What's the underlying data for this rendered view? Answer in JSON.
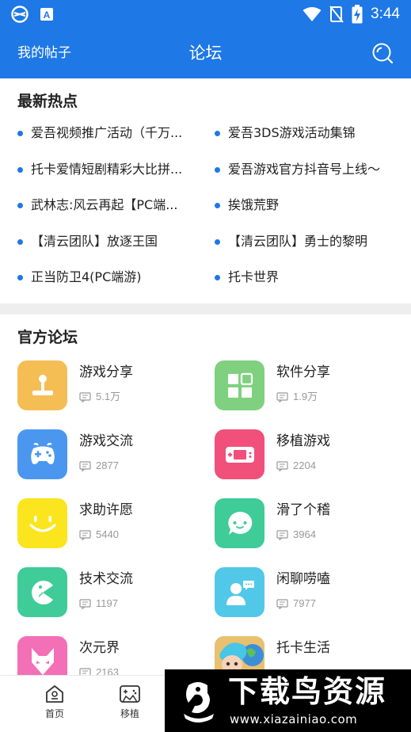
{
  "status_bar": {
    "time": "3:44"
  },
  "header": {
    "my_posts": "我的帖子",
    "title": "论坛"
  },
  "hot": {
    "title": "最新热点",
    "items": [
      {
        "label": "爱吾视频推广活动（千万..."
      },
      {
        "label": "爱吾3DS游戏活动集锦"
      },
      {
        "label": "托卡爱情短剧精彩大比拼..."
      },
      {
        "label": "爱吾游戏官方抖音号上线～"
      },
      {
        "label": "武林志:风云再起【PC端..."
      },
      {
        "label": "挨饿荒野"
      },
      {
        "label": "【清云团队】放逐王国"
      },
      {
        "label": "【清云团队】勇士的黎明"
      },
      {
        "label": "正当防卫4(PC端游)"
      },
      {
        "label": "托卡世界"
      }
    ]
  },
  "official": {
    "title": "官方论坛",
    "forums": [
      {
        "name": "游戏分享",
        "count": "5.1万",
        "icon": "joystick-icon",
        "color": "#f5be55"
      },
      {
        "name": "软件分享",
        "count": "1.9万",
        "icon": "apps-grid-icon",
        "color": "#7fd17f"
      },
      {
        "name": "游戏交流",
        "count": "2877",
        "icon": "gamepad-icon",
        "color": "#4b97f0"
      },
      {
        "name": "移植游戏",
        "count": "2204",
        "icon": "handheld-console-icon",
        "color": "#f0507a"
      },
      {
        "name": "求助许愿",
        "count": "5440",
        "icon": "smiley-icon",
        "color": "#fae51f"
      },
      {
        "name": "滑了个稽",
        "count": "3964",
        "icon": "chat-bubble-icon",
        "color": "#3fcc98"
      },
      {
        "name": "技术交流",
        "count": "1197",
        "icon": "pacman-icon",
        "color": "#3fcc98"
      },
      {
        "name": "闲聊唠嗑",
        "count": "7977",
        "icon": "user-chat-icon",
        "color": "#52c8e8"
      },
      {
        "name": "次元界",
        "count": "2163",
        "icon": "fox-mask-icon",
        "color": "#f36fb6"
      },
      {
        "name": "托卡生活",
        "count": "",
        "icon": "toca-character-icon",
        "color": "#8fd0f0"
      }
    ]
  },
  "bottom_nav": [
    {
      "label": "首页",
      "icon": "home-icon"
    },
    {
      "label": "移植",
      "icon": "gamepad-icon"
    }
  ],
  "watermark": {
    "title": "下载鸟资源",
    "url": "www.xiazainiao.com"
  }
}
